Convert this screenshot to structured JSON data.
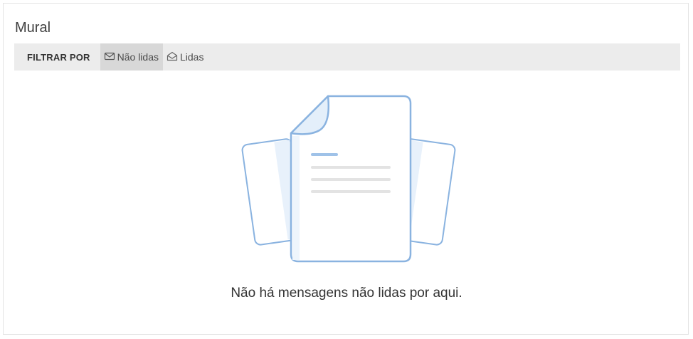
{
  "card": {
    "title": "Mural"
  },
  "filter": {
    "label": "FILTRAR POR",
    "options": [
      {
        "label": "Não lidas",
        "icon": "envelope-closed-icon",
        "active": true
      },
      {
        "label": "Lidas",
        "icon": "envelope-open-icon",
        "active": false
      }
    ]
  },
  "empty_state": {
    "message": "Não há mensagens não lidas por aqui.",
    "illustration": "documents-icon"
  },
  "colors": {
    "accent_stroke": "#8ab3e0",
    "accent_fill": "#e4effa",
    "line_gray": "#e3e3e3",
    "bar_bg": "#ececec",
    "active_bg": "#d8d8d8"
  }
}
